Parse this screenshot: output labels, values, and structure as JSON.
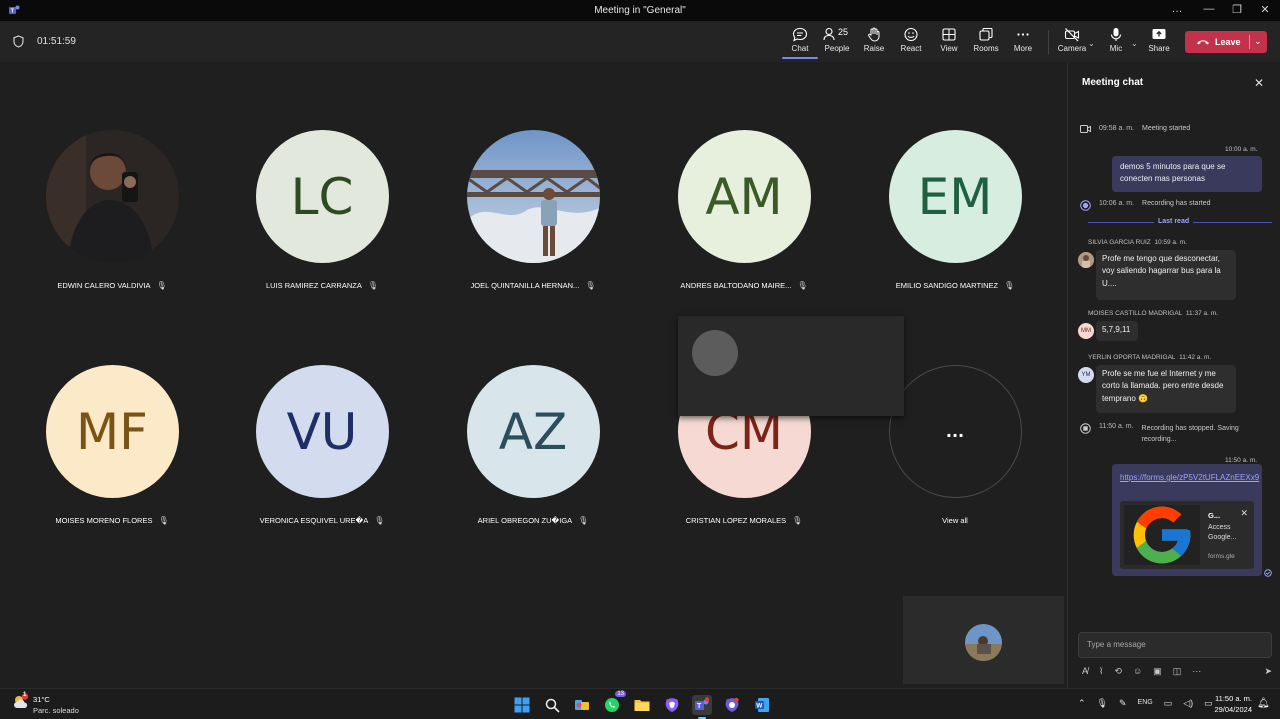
{
  "window": {
    "title": "Meeting in \"General\"",
    "controls": [
      "…",
      "—",
      "❐",
      "✕"
    ]
  },
  "toolbar": {
    "timer": "01:51:59",
    "buttons": [
      {
        "label": "Chat",
        "icon": "chat-icon"
      },
      {
        "label": "People",
        "icon": "people-icon",
        "count": "25"
      },
      {
        "label": "Raise",
        "icon": "raise-hand-icon"
      },
      {
        "label": "React",
        "icon": "react-icon"
      },
      {
        "label": "View",
        "icon": "view-icon"
      },
      {
        "label": "Rooms",
        "icon": "rooms-icon"
      },
      {
        "label": "More",
        "icon": "more-icon"
      },
      {
        "label": "Camera",
        "icon": "camera-off-icon"
      },
      {
        "label": "Mic",
        "icon": "mic-icon"
      },
      {
        "label": "Share",
        "icon": "share-icon"
      }
    ],
    "leave_label": "Leave"
  },
  "participants": [
    {
      "name": "EDWIN CALERO VALDIVIA",
      "initials": "",
      "photo": true
    },
    {
      "name": "LUIS RAMIREZ CARRANZA",
      "initials": "LC",
      "bg": "#e3e8dc",
      "fg": "#2e4a22"
    },
    {
      "name": "JOEL QUINTANILLA HERNAN...",
      "initials": "",
      "photo": true
    },
    {
      "name": "ANDRES BALTODANO MAIRE...",
      "initials": "AM",
      "bg": "#e6f0dc",
      "fg": "#3b5a28"
    },
    {
      "name": "EMILIO SANDIGO MARTINEZ",
      "initials": "EM",
      "bg": "#d6ede0",
      "fg": "#1f6040"
    },
    {
      "name": "MOISES MORENO FLORES",
      "initials": "MF",
      "bg": "#fbe9c8",
      "fg": "#7a5414"
    },
    {
      "name": "VERONICA ESQUIVEL URE�A",
      "initials": "VU",
      "bg": "#d2dcee",
      "fg": "#1d2f66"
    },
    {
      "name": "ARIEL OBREGON ZU�IGA",
      "initials": "AZ",
      "bg": "#d8e6ec",
      "fg": "#2c4e5a"
    },
    {
      "name": "CRISTIAN LOPEZ MORALES",
      "initials": "CM",
      "bg": "#f6d9d2",
      "fg": "#7c2418"
    }
  ],
  "view_all": {
    "label": "View all",
    "glyph": "..."
  },
  "chat": {
    "title": "Meeting chat",
    "messages": {
      "meeting_started_time": "09:58 a. m.",
      "meeting_started_text": "Meeting started",
      "my_msg1_time": "10:00 a. m.",
      "my_msg1_text": "demos 5 minutos para que se conecten mas personas",
      "rec_started_time": "10:06 a. m.",
      "rec_started_text": "Recording has started",
      "last_read": "Last read",
      "m1_sender": "SILVIA GARCIA RUIZ",
      "m1_time": "10:59 a. m.",
      "m1_text": "Profe me tengo que desconectar, voy saliendo hagarrar bus para la U....",
      "m2_sender": "MOISES CASTILLO MADRIGAL",
      "m2_time": "11:37 a. m.",
      "m2_initials": "MM",
      "m2_text": "5,7,9,11",
      "m3_sender": "YERLIN OPORTA MADRIGAL",
      "m3_time": "11:42 a. m.",
      "m3_initials": "YM",
      "m3_text": "Profe se me fue el Internet y me corto la llamada. pero entre desde temprano 🙃",
      "rec_stopped_time": "11:50 a. m.",
      "rec_stopped_text": "Recording has stopped. Saving recording...",
      "my_msg2_time": "11:50 a. m.",
      "my_msg2_link": "https://forms.gle/zP5V2tUFLAZnEEXx9",
      "card_title": "G...",
      "card_desc": "Access Google...",
      "card_site": "forms.gle"
    },
    "compose_placeholder": "Type a message"
  },
  "taskbar": {
    "temp": "31°C",
    "weather": "Parc. soleado",
    "weather_badge": "1",
    "lang": "ENG",
    "time": "11:50 a. m.",
    "date": "29/04/2024",
    "whatsapp_badge": "13"
  }
}
